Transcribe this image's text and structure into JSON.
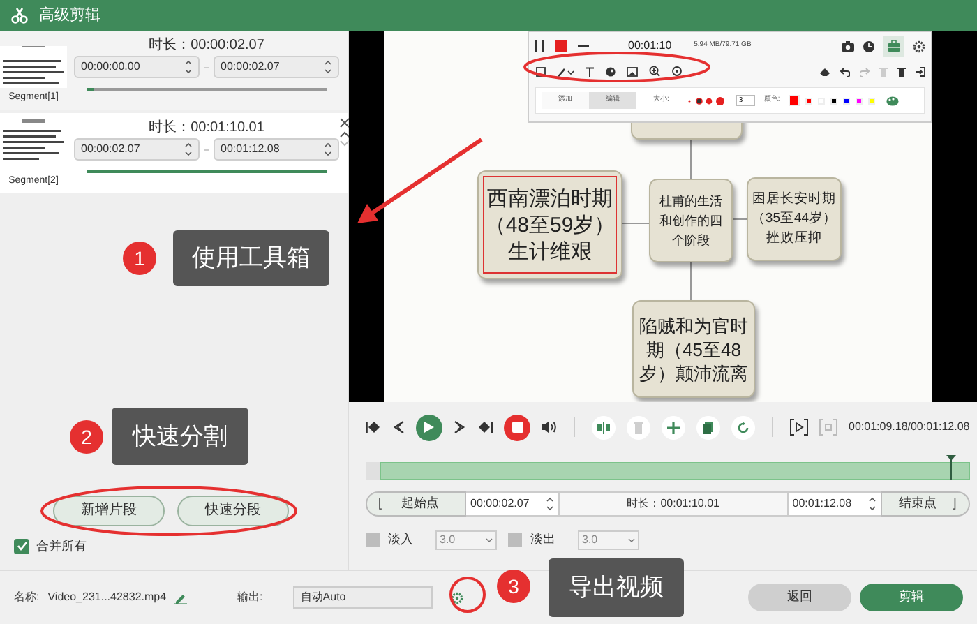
{
  "window": {
    "title": "高级剪辑"
  },
  "segments": [
    {
      "label": "Segment[1]",
      "duration": "时长：00:00:02.07",
      "start": "00:00:00.00",
      "end": "00:00:02.07",
      "selected": false,
      "level": 0.03
    },
    {
      "label": "Segment[2]",
      "duration": "时长：00:01:10.01",
      "start": "00:00:02.07",
      "end": "00:01:12.08",
      "selected": true,
      "level": 1
    }
  ],
  "segment_buttons": [
    "新增片段",
    "快速分段"
  ],
  "merge_all": {
    "label": "合并所有",
    "checked": true
  },
  "video_frame": {
    "recorder_toolbar": {
      "time": "00:01:10",
      "storage": "5.94 MB/79.71 GB",
      "tabs": [
        {
          "label": "添加",
          "selected": false
        },
        {
          "label": "编辑",
          "selected": true
        }
      ],
      "size_label": "大小:",
      "size_value": "3",
      "color_label": "颜色:",
      "colors": [
        {
          "color": "#ff0000",
          "selected": true
        },
        {
          "color": "#ff0000",
          "selected": false
        },
        {
          "color": "#ffffff",
          "selected": false
        },
        {
          "color": "#000000",
          "selected": false
        },
        {
          "color": "#0000ff",
          "selected": false
        },
        {
          "color": "#ff00ff",
          "selected": false
        },
        {
          "color": "#ffff00",
          "selected": false
        }
      ]
    },
    "mindmap": {
      "center": "杜甫的生活和创作的四个阶段",
      "nodes": [
        {
          "kind": "left",
          "text": "西南漂泊时期（48至59岁）生计维艰",
          "selected": true
        },
        {
          "kind": "right",
          "text": "困居长安时期（35至44岁）挫败压抑",
          "selected": false
        },
        {
          "kind": "bottom",
          "text": "陷贼和为官时期（45至48岁）颠沛流离",
          "selected": false
        }
      ]
    }
  },
  "player": {
    "time": "00:01:09.18/00:01:12.08",
    "level": 0.97
  },
  "range": {
    "start_bracket": "[",
    "start_button": "起始点",
    "start": "00:00:02.07",
    "duration": "时长：00:01:10.01",
    "end": "00:01:12.08",
    "end_button": "结束点",
    "end_bracket": "]"
  },
  "fades": [
    {
      "label": "淡入",
      "checked": false,
      "value": "3.0"
    },
    {
      "label": "淡出",
      "checked": false,
      "value": "3.0"
    }
  ],
  "output": {
    "name_label": "名称:",
    "name": "Video_231...42832.mp4",
    "output_label": "输出:",
    "output": "自动Auto"
  },
  "actions": [
    {
      "kind": "secondary",
      "label": "返回"
    },
    {
      "kind": "primary",
      "label": "剪辑"
    }
  ],
  "annotations": [
    {
      "number": "1",
      "text": "使用工具箱"
    },
    {
      "number": "2",
      "text": "快速分割"
    },
    {
      "number": "3",
      "text": "导出视频"
    }
  ]
}
